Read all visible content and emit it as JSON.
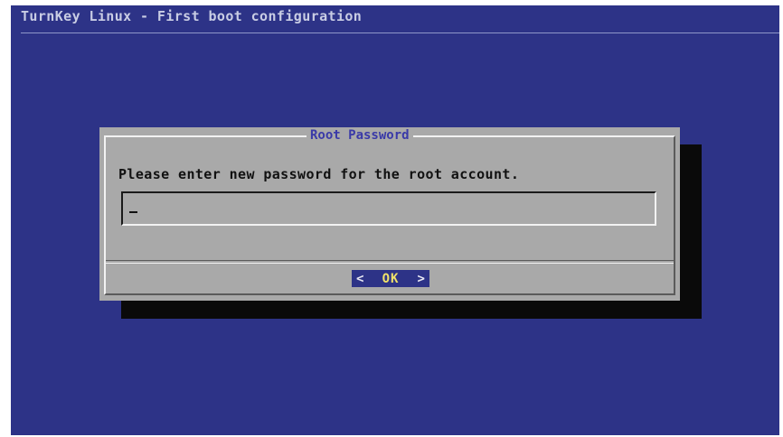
{
  "header": {
    "title": "TurnKey Linux - First boot configuration"
  },
  "dialog": {
    "title": "Root Password",
    "prompt": "Please enter new password for the root account.",
    "password_value": "",
    "ok_button": {
      "left_bracket": "<",
      "label": "OK",
      "right_bracket": ">"
    }
  },
  "colors": {
    "background": "#2d3387",
    "dialog": "#a9a9a9",
    "title_text": "#3a3aa8",
    "button_highlight": "#2d3387",
    "button_label": "#f0e26a"
  }
}
